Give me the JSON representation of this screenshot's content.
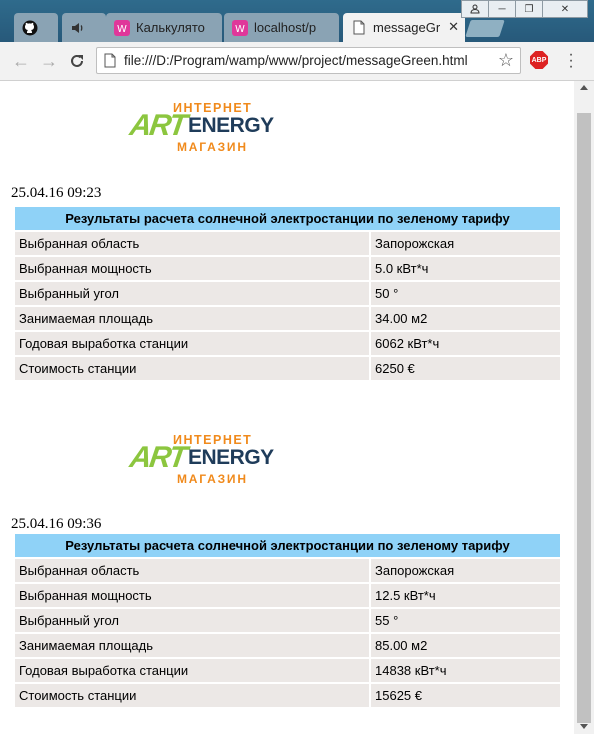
{
  "tabs": [
    {
      "title": "",
      "icon": "github-icon"
    },
    {
      "title": "",
      "icon": "speaker-icon"
    },
    {
      "title": "Калькулято",
      "icon": "app-icon"
    },
    {
      "title": "localhost/p",
      "icon": "app-icon"
    },
    {
      "title": "messageGr",
      "icon": "page-icon",
      "active": true
    }
  ],
  "address": {
    "url": "file:///D:/Program/wamp/www/project/messageGreen.html"
  },
  "extension": {
    "label": "ABP"
  },
  "logo": {
    "top": "ИНТЕРНЕТ",
    "art": "ART",
    "energy": "ENERGY",
    "bottom": "МАГАЗИН"
  },
  "reports": [
    {
      "timestamp": "25.04.16 09:23",
      "header": "Результаты расчета солнечной электростанции по зеленому тарифу",
      "rows": [
        {
          "label": "Выбранная область",
          "value": "Запорожская"
        },
        {
          "label": "Выбранная мощность",
          "value": "5.0 кВт*ч"
        },
        {
          "label": "Выбранный угол",
          "value": "50 °"
        },
        {
          "label": "Занимаемая площадь",
          "value": "34.00 м2"
        },
        {
          "label": "Годовая выработка станции",
          "value": "6062 кВт*ч"
        },
        {
          "label": "Стоимость станции",
          "value": "6250 €"
        }
      ]
    },
    {
      "timestamp": "25.04.16 09:36",
      "header": "Результаты расчета солнечной электростанции по зеленому тарифу",
      "rows": [
        {
          "label": "Выбранная область",
          "value": "Запорожская"
        },
        {
          "label": "Выбранная мощность",
          "value": "12.5 кВт*ч"
        },
        {
          "label": "Выбранный угол",
          "value": "55 °"
        },
        {
          "label": "Занимаемая площадь",
          "value": "85.00 м2"
        },
        {
          "label": "Годовая выработка станции",
          "value": "14838 кВт*ч"
        },
        {
          "label": "Стоимость станции",
          "value": "15625 €"
        }
      ]
    }
  ],
  "colors": {
    "table_header": "#8fd2f7",
    "table_cell": "#ece8e6",
    "logo_orange": "#f08a1c",
    "logo_green": "#8cc63f",
    "logo_navy": "#1f3c5a"
  }
}
